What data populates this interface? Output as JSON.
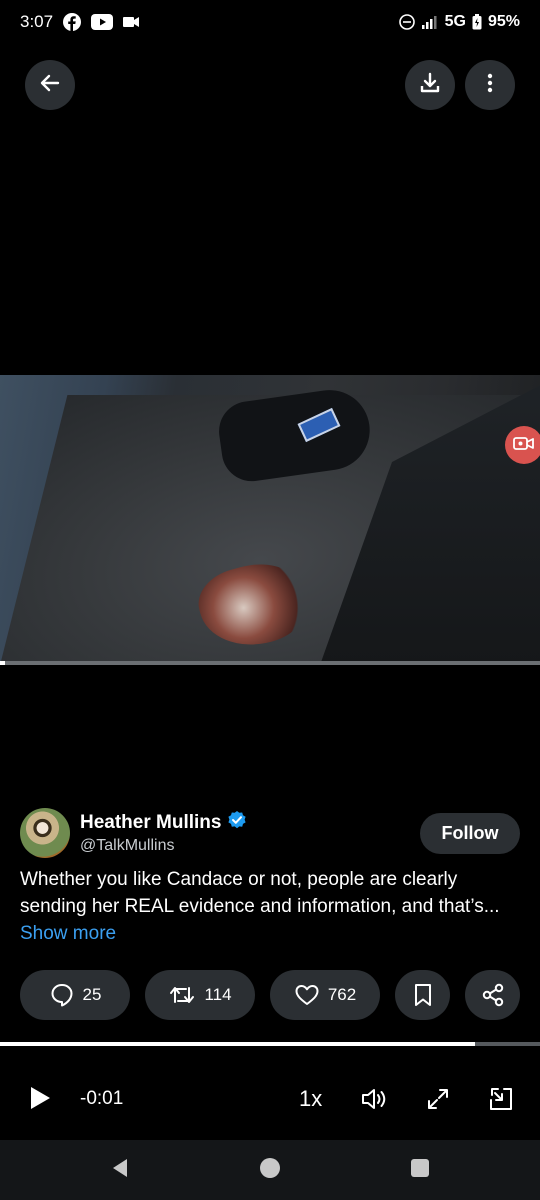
{
  "status_bar": {
    "time": "3:07",
    "network": "5G",
    "battery": "95%",
    "icons": [
      "facebook-icon",
      "youtube-icon",
      "video-camera-icon",
      "do-not-disturb-icon",
      "signal-icon",
      "battery-icon"
    ]
  },
  "top_controls": {
    "icons": [
      "back-arrow-icon",
      "download-icon",
      "more-vertical-icon"
    ]
  },
  "video": {
    "playback_progress": 0.01,
    "record_icon": "video-record-icon"
  },
  "post": {
    "author_name": "Heather Mullins",
    "author_handle": "@TalkMullins",
    "verified": true,
    "follow_label": "Follow",
    "text": "Whether you like Candace or not, people are clearly sending her REAL evidence and information, and that’s...",
    "show_more_label": "Show more"
  },
  "actions": {
    "replies": "25",
    "reposts": "114",
    "likes": "762",
    "icons": [
      "reply-icon",
      "repost-icon",
      "like-icon",
      "bookmark-icon",
      "share-icon"
    ]
  },
  "player": {
    "progress": 0.88,
    "time_remaining": "-0:01",
    "speed": "1x",
    "icons": [
      "play-icon",
      "volume-icon",
      "fullscreen-icon",
      "minimize-icon"
    ]
  },
  "navbar": {
    "icons": [
      "nav-back-icon",
      "nav-home-icon",
      "nav-recents-icon"
    ]
  },
  "colors": {
    "background": "#000000",
    "button_bg": "#2b2f33",
    "link": "#3b9ff0",
    "verified": "#1d9bf0",
    "record": "#d9534f"
  }
}
